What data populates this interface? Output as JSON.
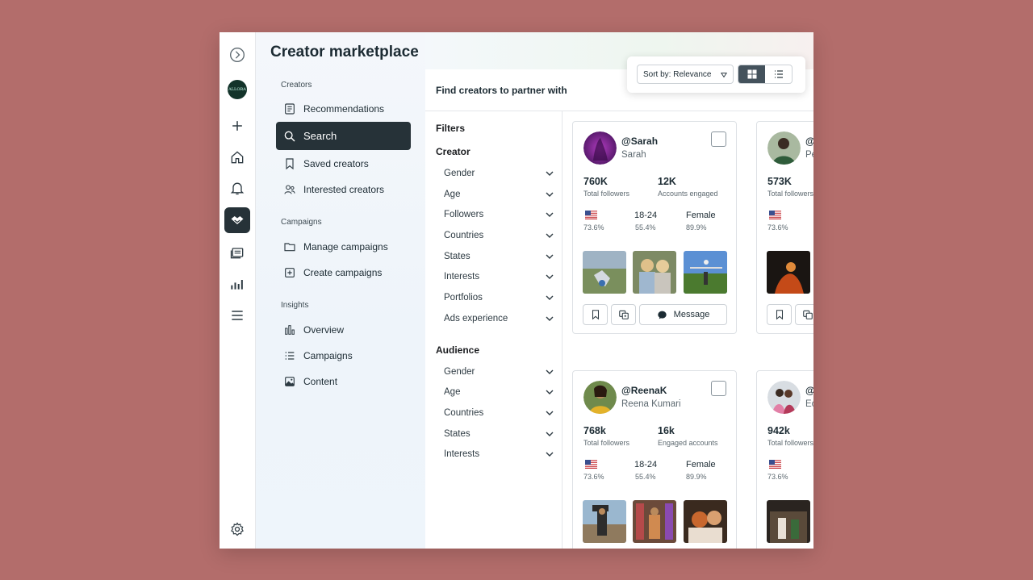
{
  "page": {
    "title": "Creator marketplace"
  },
  "nav": {
    "sections": {
      "creators": "Creators",
      "campaigns": "Campaigns",
      "insights": "Insights"
    },
    "items": [
      {
        "label": "Recommendations",
        "icon": "recommendations-icon"
      },
      {
        "label": "Search",
        "icon": "search-icon",
        "active": true
      },
      {
        "label": "Saved creators",
        "icon": "bookmark-icon"
      },
      {
        "label": "Interested creators",
        "icon": "people-icon"
      },
      {
        "label": "Manage campaigns",
        "icon": "folder-icon"
      },
      {
        "label": "Create campaigns",
        "icon": "plus-square-icon"
      },
      {
        "label": "Overview",
        "icon": "bar-chart-icon"
      },
      {
        "label": "Campaigns",
        "icon": "list-icon"
      },
      {
        "label": "Content",
        "icon": "image-icon"
      }
    ]
  },
  "main": {
    "find_title": "Find creators to partner with",
    "sort_label": "Sort by: Relevance",
    "view_modes": [
      "grid",
      "list"
    ]
  },
  "filters": {
    "title": "Filters",
    "creator_title": "Creator",
    "creator": [
      "Gender",
      "Age",
      "Followers",
      "Countries",
      "States",
      "Interests",
      "Portfolios",
      "Ads experience"
    ],
    "audience_title": "Audience",
    "audience": [
      "Gender",
      "Age",
      "Countries",
      "States",
      "Interests"
    ]
  },
  "cards": [
    {
      "handle": "@Sarah",
      "name": "Sarah",
      "followers": "760K",
      "followers_label": "Total followers",
      "engaged": "12K",
      "engaged_label": "Accounts engaged",
      "country_pct": "73.6%",
      "age": "18-24",
      "age_pct": "55.4%",
      "gender": "Female",
      "gender_pct": "89.9%",
      "message_label": "Message"
    },
    {
      "handle": "@",
      "name": "Pe",
      "followers": "573K",
      "followers_label": "Total followers",
      "country_pct": "73.6%"
    },
    {
      "handle": "@ReenaK",
      "name": "Reena Kumari",
      "followers": "768k",
      "followers_label": "Total followers",
      "engaged": "16k",
      "engaged_label": "Engaged accounts",
      "country_pct": "73.6%",
      "age": "18-24",
      "age_pct": "55.4%",
      "gender": "Female",
      "gender_pct": "89.9%"
    },
    {
      "handle": "@",
      "name": "Ec",
      "followers": "942k",
      "followers_label": "Total followers",
      "country_pct": "73.6%"
    }
  ]
}
